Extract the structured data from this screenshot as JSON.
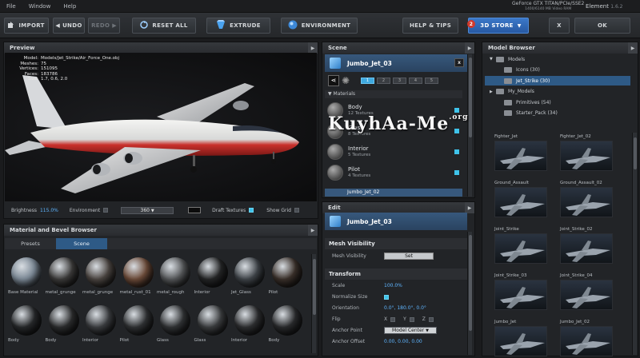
{
  "menu": [
    "File",
    "Window",
    "Help"
  ],
  "gpu": {
    "name": "GeForce GTX TITAN/PCIe/SSE2",
    "mem": "1400/6140 MB Video RAM"
  },
  "app": {
    "name": "Element",
    "version": "1.6.2"
  },
  "toolbar": {
    "import": "IMPORT",
    "undo": "UNDO",
    "redo": "REDO",
    "reset_all": "RESET ALL",
    "extrude": "EXTRUDE",
    "environment": "ENVIRONMENT",
    "help": "HELP & TIPS",
    "store_badge": "2",
    "store": "3D STORE",
    "x": "X",
    "ok": "OK"
  },
  "preview": {
    "title": "Preview",
    "stats": [
      {
        "k": "Model:",
        "v": "Models/Jet_Strike/Air_Force_One.obj"
      },
      {
        "k": "Meshes:",
        "v": "75"
      },
      {
        "k": "Vertices:",
        "v": "151095"
      },
      {
        "k": "Faces:",
        "v": "183786"
      },
      {
        "k": "Size:",
        "v": "1.7, 0.6, 2.0"
      }
    ],
    "brightness_label": "Brightness",
    "brightness": "115.0%",
    "environment_label": "Environment",
    "env_value": "360",
    "draft_label": "Draft Textures",
    "grid_label": "Show Grid"
  },
  "material_browser": {
    "title": "Material and Bevel Browser",
    "tabs": [
      "Presets",
      "Scene"
    ],
    "active_tab": "Scene",
    "row1": [
      "Base Material",
      "metal_grunge",
      "metal_grunge",
      "metal_rust_01",
      "metal_rough",
      "Interior",
      "Jet_Glass",
      "Pilot"
    ],
    "row2": [
      "Body",
      "Body",
      "Interior",
      "Pilot",
      "Glass",
      "Glass",
      "Interior",
      "Body"
    ]
  },
  "scene": {
    "title": "Scene",
    "object": "Jumbo_Jet_03",
    "lod": [
      "1",
      "2",
      "3",
      "4",
      "5"
    ],
    "materials_label": "Materials",
    "materials": [
      {
        "name": "Body",
        "sub": "12 Textures"
      },
      {
        "name": "Glass",
        "sub": "8 Textures"
      },
      {
        "name": "Interior",
        "sub": "5 Textures"
      },
      {
        "name": "Pilot",
        "sub": "4 Textures"
      }
    ],
    "next_object": "Jumbo_Jet_02"
  },
  "watermark": {
    "text": "KuyhAa-Me",
    "sub": ".org"
  },
  "edit": {
    "title": "Edit",
    "object": "Jumbo_Jet_03",
    "mesh_vis_section": "Mesh Visibility",
    "mesh_vis_label": "Mesh Visibility",
    "set_button": "Set",
    "transform_section": "Transform",
    "scale_label": "Scale",
    "scale": "100.0%",
    "normalize_label": "Normalize Size",
    "orientation_label": "Orientation",
    "orientation": "0.0°, 180.0°, 0.0°",
    "flip_label": "Flip",
    "flip_axes": [
      "X",
      "Y",
      "Z"
    ],
    "anchor_point_label": "Anchor Point",
    "anchor_point": "Model Center",
    "anchor_offset_label": "Anchor Offset",
    "anchor_offset": "0.00, 0.00, 0.00"
  },
  "model_browser": {
    "title": "Model Browser",
    "tree": [
      {
        "label": "Models",
        "indent": 0
      },
      {
        "label": "Icons (30)",
        "indent": 1
      },
      {
        "label": "Jet_Strike (30)",
        "indent": 1,
        "selected": true
      },
      {
        "label": "My_Models",
        "indent": 0
      },
      {
        "label": "Primitives (54)",
        "indent": 1
      },
      {
        "label": "Starter_Pack (34)",
        "indent": 1
      }
    ],
    "items": [
      "Fighter_Jet",
      "Fighter_Jet_02",
      "Ground_Assault",
      "Ground_Assault_02",
      "Joint_Strike",
      "Joint_Strike_02",
      "Joint_Strike_03",
      "Joint_Strike_04",
      "Jumbo_Jet",
      "Jumbo_Jet_02"
    ]
  }
}
